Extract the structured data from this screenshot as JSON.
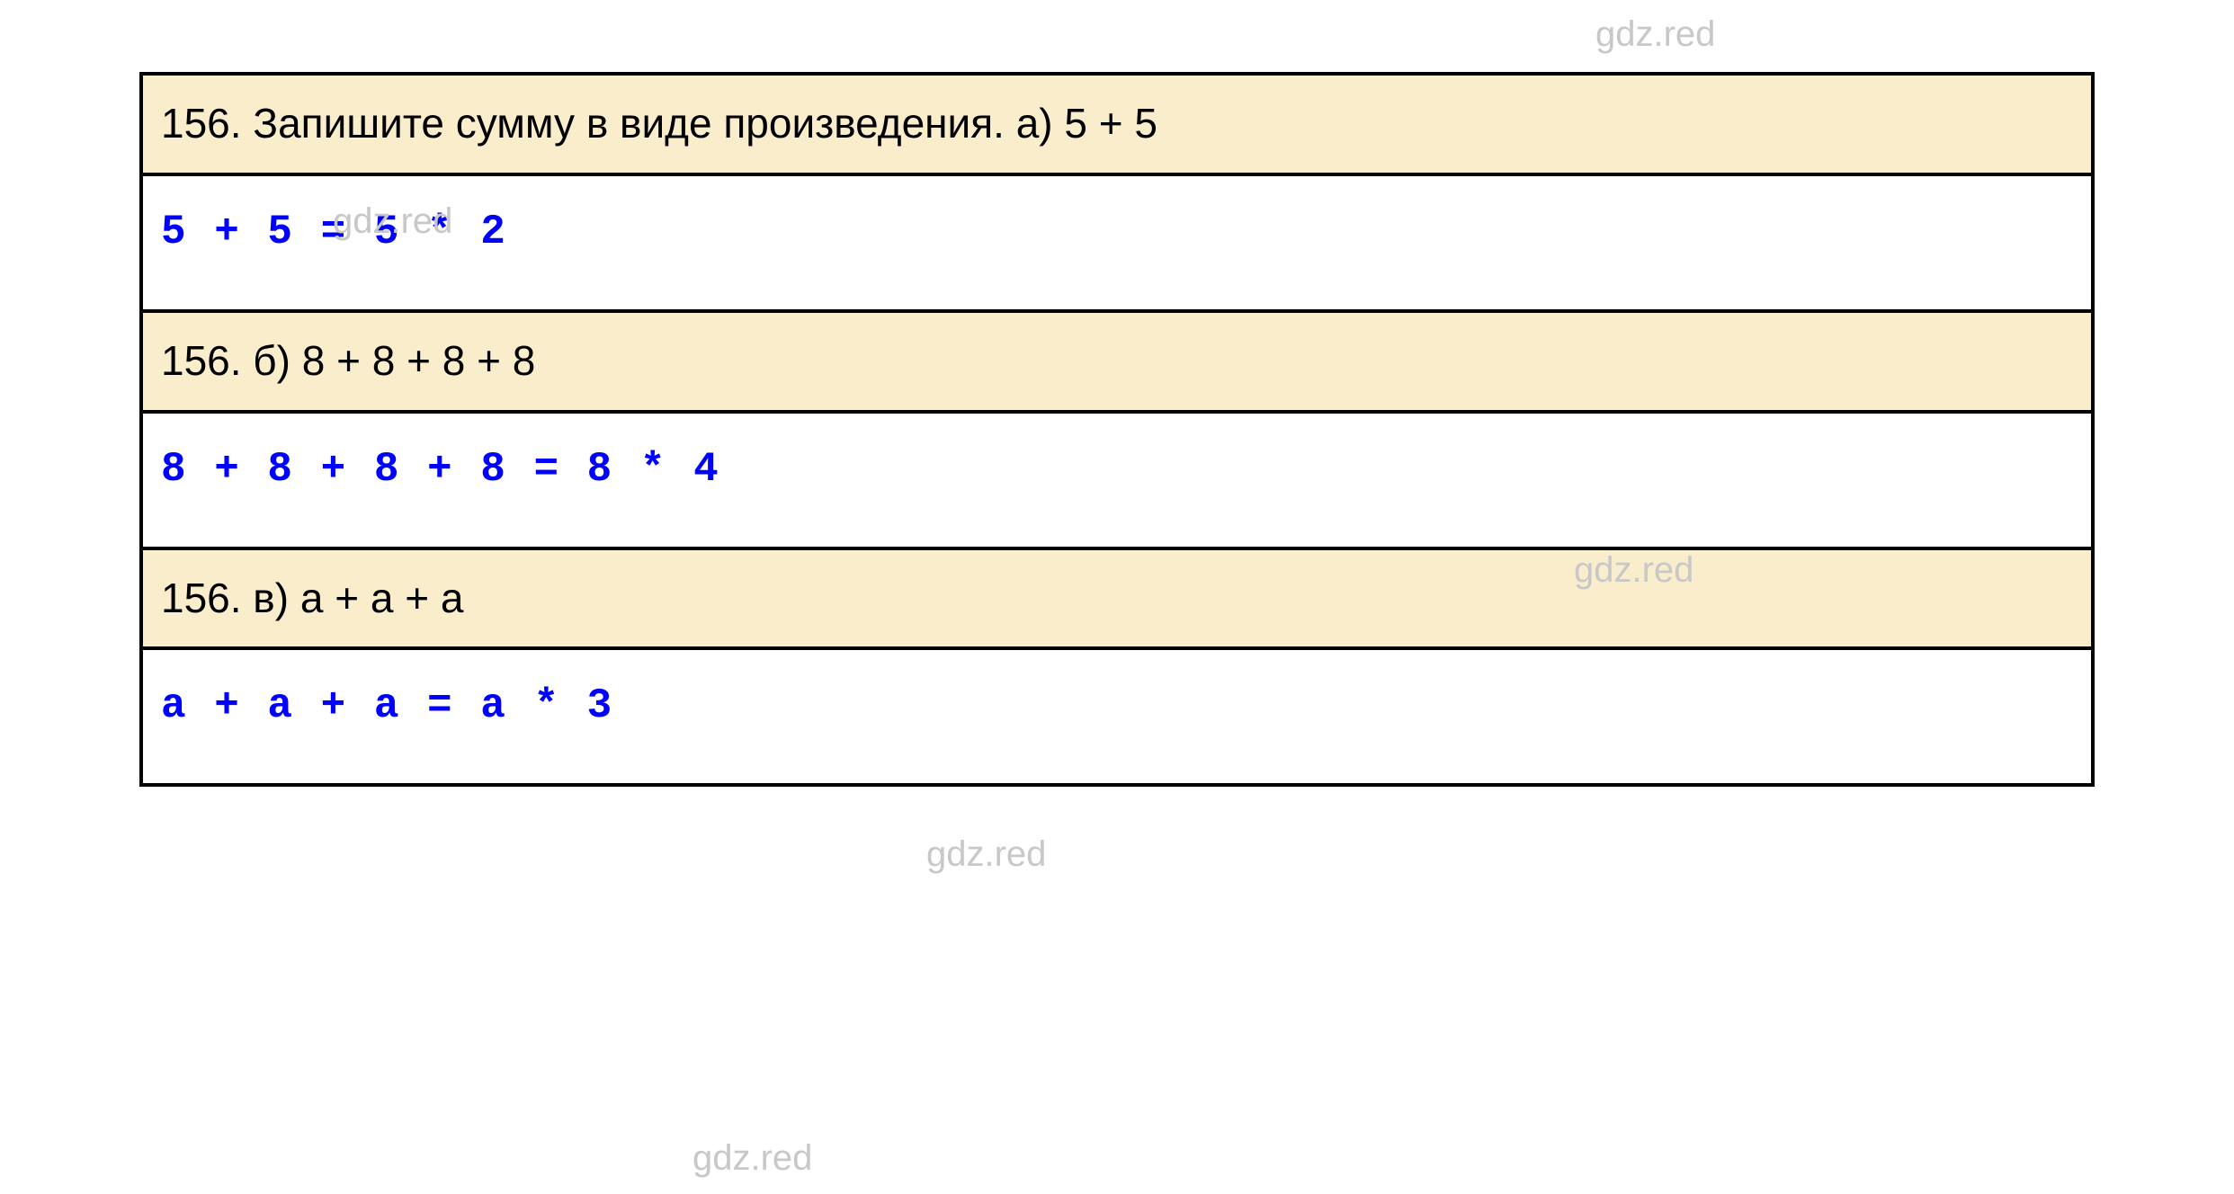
{
  "watermark": "gdz.red",
  "rows": [
    {
      "type": "question",
      "text": "156. Запишите сумму в виде произведения. а) 5 + 5"
    },
    {
      "type": "answer",
      "text": "5 + 5 = 5 * 2"
    },
    {
      "type": "question",
      "text": "156. б) 8 + 8 + 8 + 8"
    },
    {
      "type": "answer",
      "text": "8 + 8 + 8 + 8 = 8 * 4"
    },
    {
      "type": "question",
      "text": "156. в) а + а + а"
    },
    {
      "type": "answer",
      "text": "а + а + а = а * 3"
    }
  ]
}
